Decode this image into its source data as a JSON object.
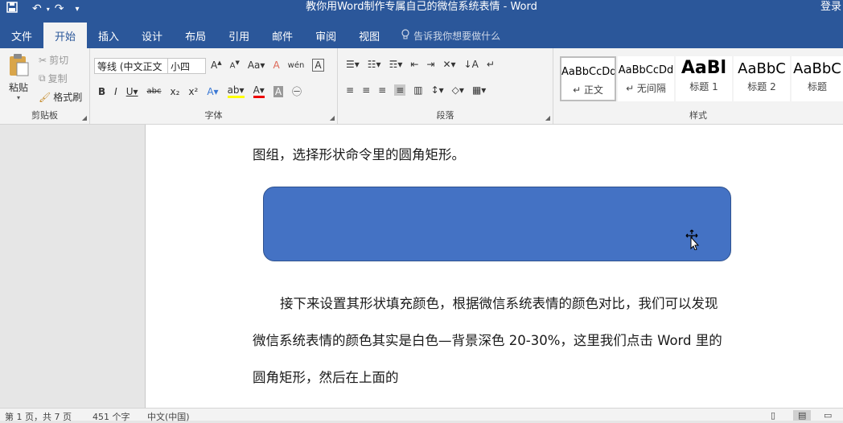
{
  "window": {
    "title": "教你用Word制作专属自己的微信系统表情  -  Word",
    "login": "登录"
  },
  "tabs": [
    {
      "label": "文件"
    },
    {
      "label": "开始"
    },
    {
      "label": "插入"
    },
    {
      "label": "设计"
    },
    {
      "label": "布局"
    },
    {
      "label": "引用"
    },
    {
      "label": "邮件"
    },
    {
      "label": "审阅"
    },
    {
      "label": "视图"
    }
  ],
  "tellme": "告诉我你想要做什么",
  "clipboard": {
    "paste": "粘贴",
    "cut": "剪切",
    "copy": "复制",
    "format_painter": "格式刷",
    "label": "剪贴板"
  },
  "font": {
    "name": "等线 (中文正文",
    "size": "小四",
    "label": "字体"
  },
  "paragraph": {
    "label": "段落"
  },
  "styles": {
    "label": "样式",
    "items": [
      {
        "sample": "AaBbCcDd",
        "name": "↵ 正文"
      },
      {
        "sample": "AaBbCcDd",
        "name": "↵ 无间隔"
      },
      {
        "sample": "AaBl",
        "name": "标题 1"
      },
      {
        "sample": "AaBbC",
        "name": "标题 2"
      },
      {
        "sample": "AaBbC",
        "name": "标题"
      }
    ]
  },
  "document": {
    "line1": "图组，选择形状命令里的圆角矩形。",
    "line2": "接下来设置其形状填充颜色，根据微信系统表情的颜色对比，我们可以发现",
    "line3": "微信系统表情的颜色其实是白色—背景深色 20-30%，这里我们点击 Word 里的",
    "line4": "圆角矩形，然后在上面的"
  },
  "status": {
    "page": "第 1 页，共 7 页",
    "words": "451 个字",
    "lang": "中文(中国)"
  },
  "colors": {
    "accent": "#2b579a",
    "shape": "#4472c4"
  }
}
